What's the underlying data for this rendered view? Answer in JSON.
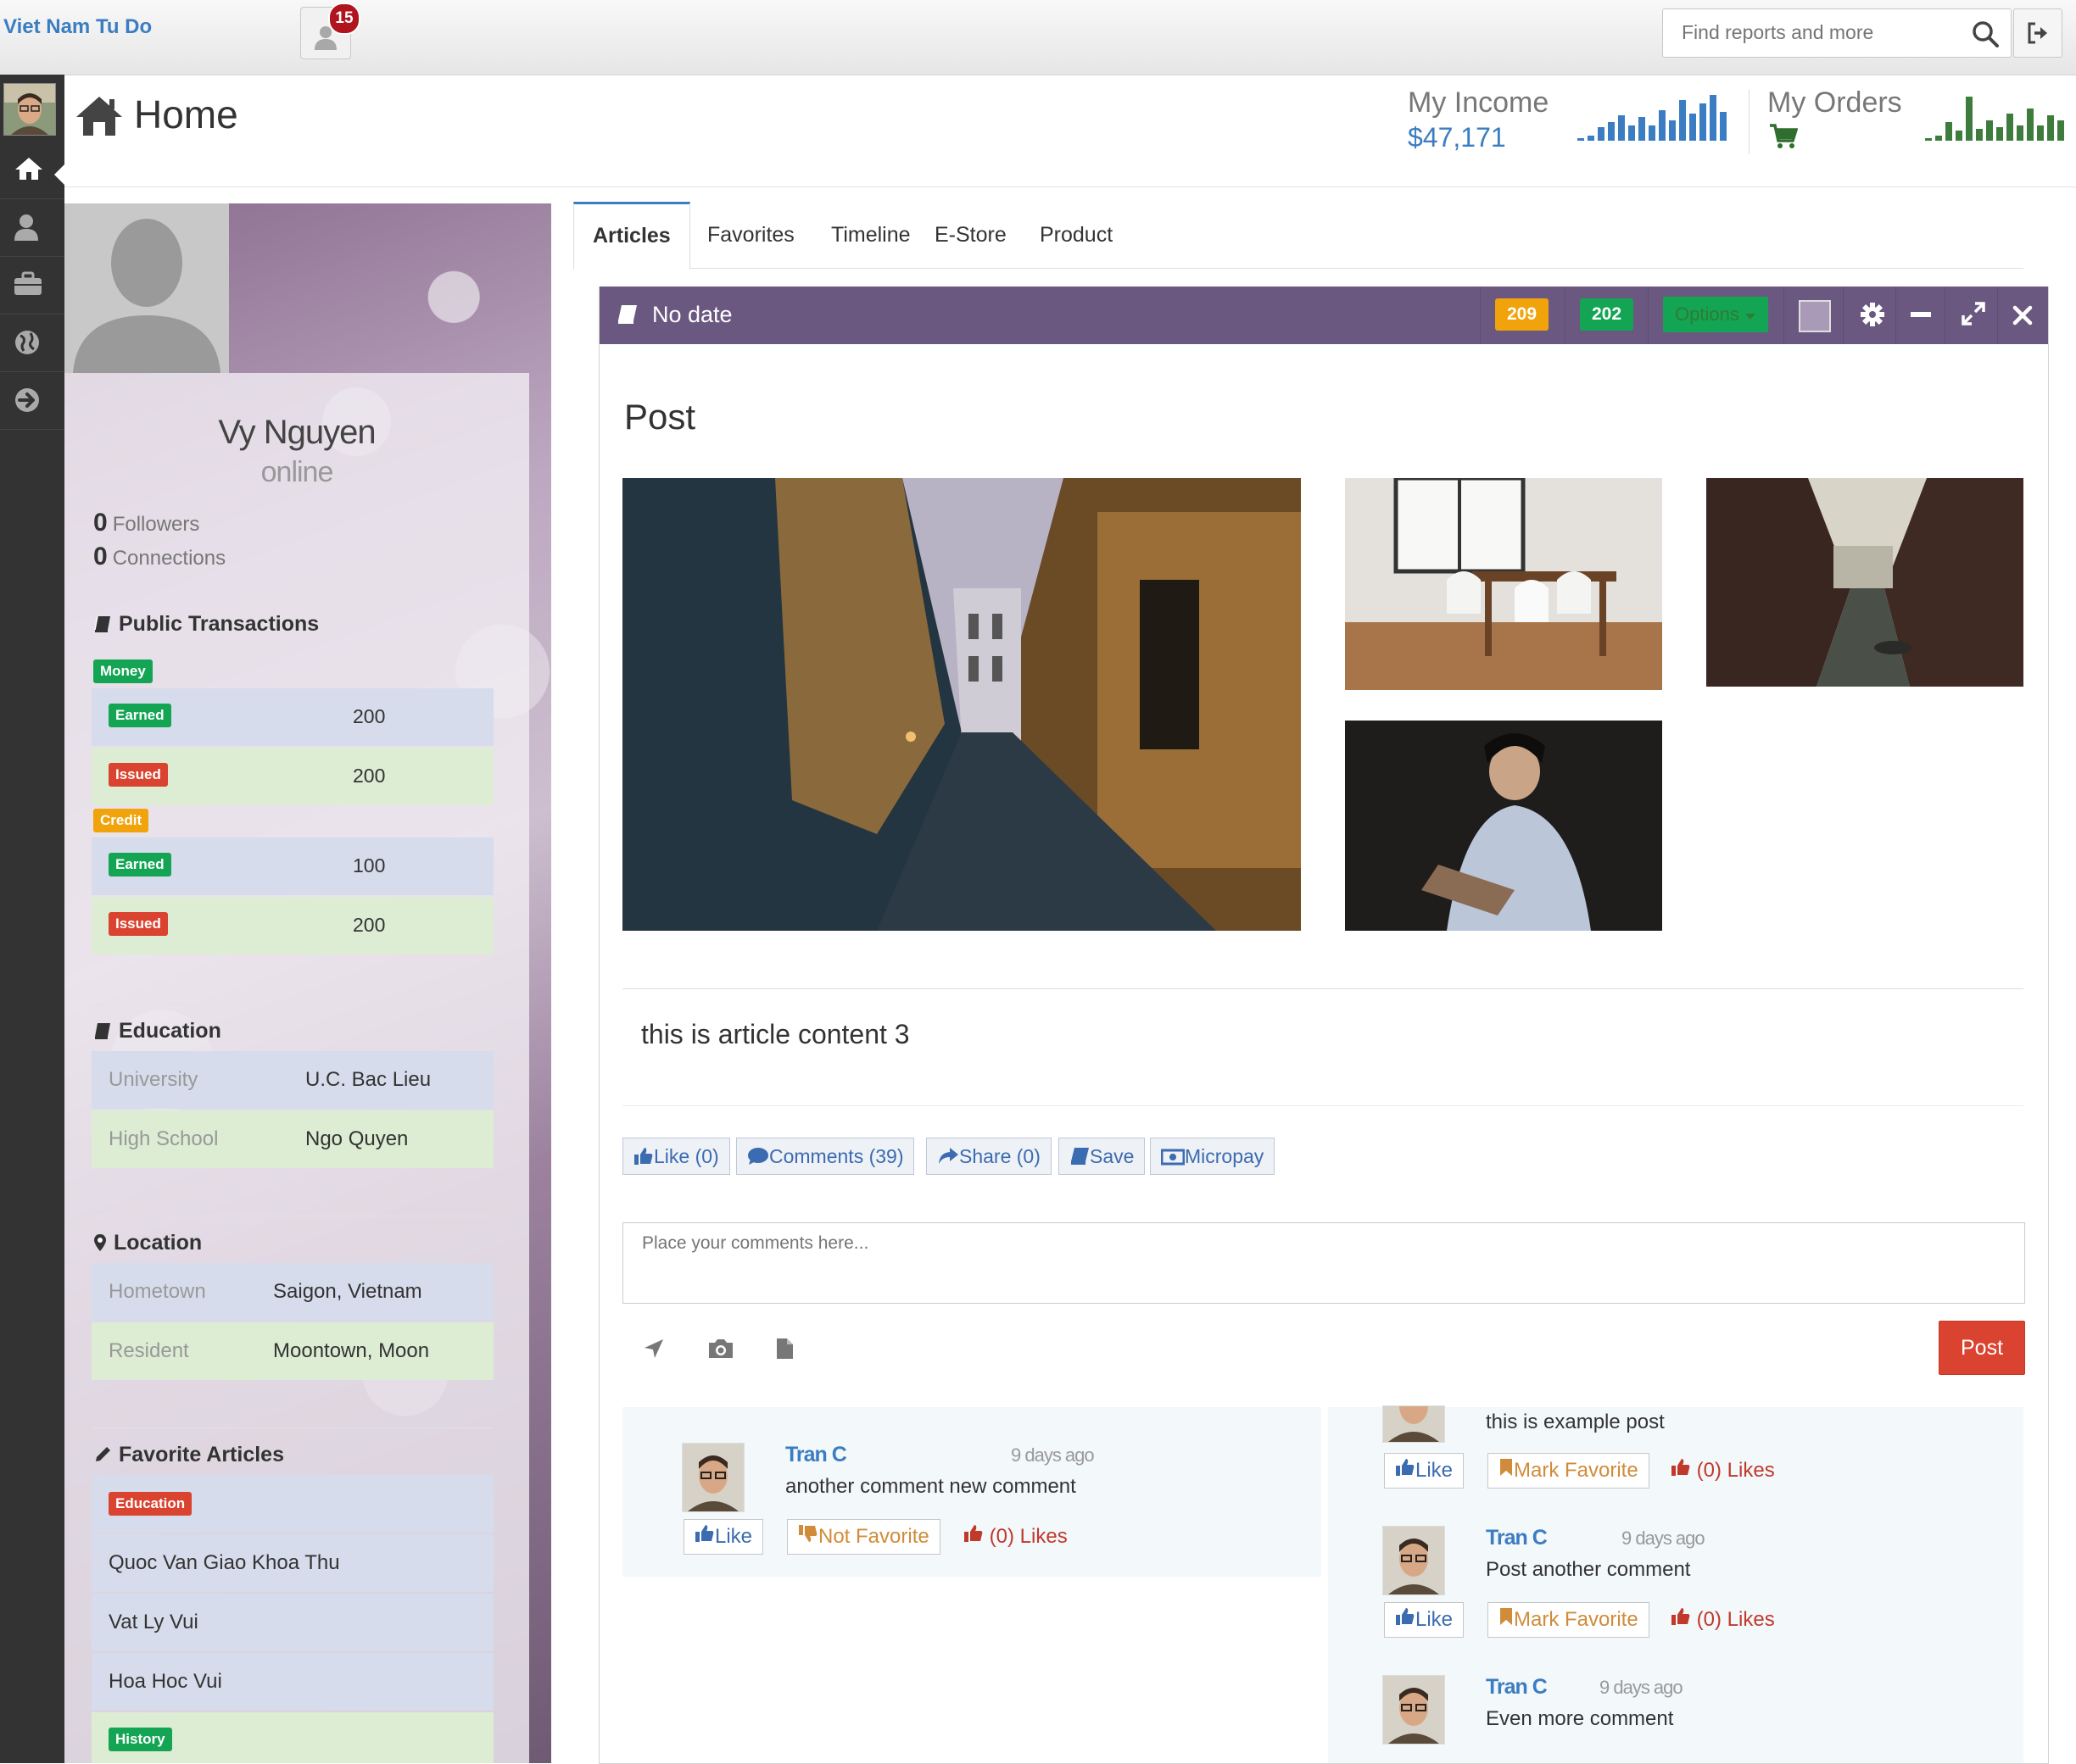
{
  "topbar": {
    "brand": "Viet Nam Tu Do",
    "notifications_count": "15",
    "search_placeholder": "Find reports and more"
  },
  "header": {
    "title": "Home",
    "income_label": "My Income",
    "income_value": "$47,171",
    "orders_label": "My Orders"
  },
  "profile": {
    "name": "Vy Nguyen",
    "status": "online",
    "followers_count": "0",
    "followers_label": "Followers",
    "connections_count": "0",
    "connections_label": "Connections",
    "public_transactions_title": "Public Transactions",
    "money_label": "Money",
    "credit_label": "Credit",
    "earned_label": "Earned",
    "issued_label": "Issued",
    "money_earned": "200",
    "money_issued": "200",
    "credit_earned": "100",
    "credit_issued": "200",
    "education_title": "Education",
    "education": [
      {
        "key": "University",
        "value": "U.C. Bac Lieu"
      },
      {
        "key": "High School",
        "value": "Ngo Quyen"
      }
    ],
    "location_title": "Location",
    "location": [
      {
        "key": "Hometown",
        "value": "Saigon, Vietnam"
      },
      {
        "key": "Resident",
        "value": "Moontown, Moon"
      }
    ],
    "favorite_title": "Favorite Articles",
    "favorite_category": "Education",
    "favorite_articles": [
      "Quoc Van Giao Khoa Thu",
      "Vat Ly Vui",
      "Hoa Hoc Vui"
    ],
    "history_label": "History"
  },
  "tabs": [
    "Articles",
    "Favorites",
    "Timeline",
    "E-Store",
    "Product"
  ],
  "widget": {
    "title": "No date",
    "badge_1": "209",
    "badge_2": "202",
    "options_label": "Options"
  },
  "post": {
    "heading": "Post",
    "content": "this is article content 3",
    "actions": {
      "like": "Like (0)",
      "comments": "Comments (39)",
      "share": "Share (0)",
      "save": "Save",
      "micropay": "Micropay"
    },
    "comment_placeholder": "Place your comments here...",
    "post_button": "Post"
  },
  "comments_left": [
    {
      "author": "Tran C",
      "time": "9 days ago",
      "text": "another comment new comment",
      "like": "Like",
      "fav": "Not Favorite",
      "likes": "(0) Likes"
    }
  ],
  "comments_right": [
    {
      "text": "this is example post",
      "like": "Like",
      "fav": "Mark Favorite",
      "likes": "(0) Likes"
    },
    {
      "author": "Tran C",
      "time": "9 days ago",
      "text": "Post another comment",
      "like": "Like",
      "fav": "Mark Favorite",
      "likes": "(0) Likes"
    },
    {
      "author": "Tran C",
      "time": "9 days ago",
      "text": "Even more comment"
    }
  ],
  "colors": {
    "brand": "#3b7dc2",
    "widget_header": "#6b5880",
    "badge_orange": "#f0a30a",
    "badge_green": "#13a454",
    "danger": "#d9432f"
  }
}
